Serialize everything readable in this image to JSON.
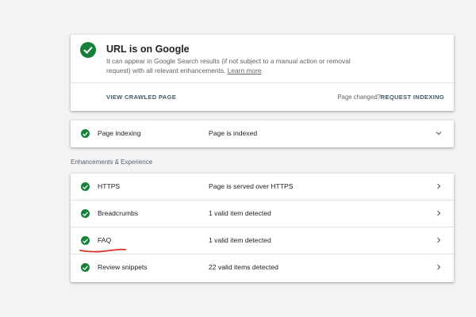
{
  "status": {
    "title": "URL is on Google",
    "description": "It can appear in Google Search results (if not subject to a manual action or removal request) with all relevant enhancements.",
    "learn_more": "Learn more",
    "view_crawled_label": "VIEW CRAWLED PAGE",
    "page_changed_label": "Page changed?",
    "request_indexing_label": "REQUEST INDEXING"
  },
  "indexing": {
    "name": "Page indexing",
    "value": "Page is indexed"
  },
  "enhancements": {
    "section_label": "Enhancements & Experience",
    "rows": [
      {
        "name": "HTTPS",
        "value": "Page is served over HTTPS"
      },
      {
        "name": "Breadcrumbs",
        "value": "1 valid item detected"
      },
      {
        "name": "FAQ",
        "value": "1 valid item detected"
      },
      {
        "name": "Review snippets",
        "value": "22 valid items detected"
      }
    ]
  },
  "colors": {
    "success_green": "#188038",
    "annotation_red": "#d93025"
  },
  "icons": {
    "status": "check-circle-icon",
    "row_status": "check-circle-icon",
    "expand": "chevron-down-icon",
    "navigate": "chevron-right-icon"
  }
}
